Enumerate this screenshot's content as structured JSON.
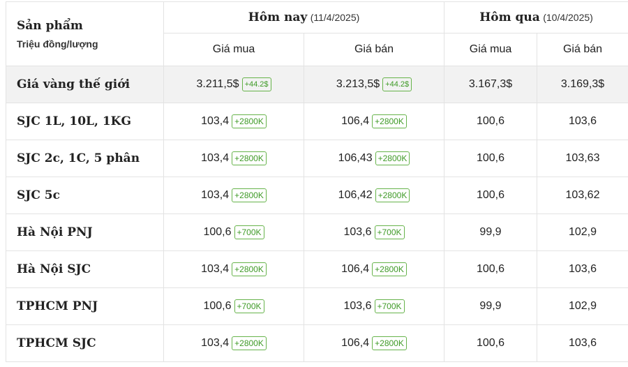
{
  "header": {
    "product_title": "Sản phẩm",
    "unit": "Triệu đồng/lượng",
    "today_title": "Hôm nay",
    "today_date": "(11/4/2025)",
    "yesterday_title": "Hôm qua",
    "yesterday_date": "(10/4/2025)",
    "buy_label": "Giá mua",
    "sell_label": "Giá bán"
  },
  "colors": {
    "badge_green": "#3f9a27",
    "world_row_bg": "#f2f2f2",
    "border": "#e3e3e3"
  },
  "rows": [
    {
      "name": "Giá vàng thế giới",
      "today_buy": "3.211,5$",
      "today_buy_change": "+44.2$",
      "today_sell": "3.213,5$",
      "today_sell_change": "+44.2$",
      "yesterday_buy": "3.167,3$",
      "yesterday_sell": "3.169,3$"
    },
    {
      "name": "SJC 1L, 10L, 1KG",
      "today_buy": "103,4",
      "today_buy_change": "+2800K",
      "today_sell": "106,4",
      "today_sell_change": "+2800K",
      "yesterday_buy": "100,6",
      "yesterday_sell": "103,6"
    },
    {
      "name": "SJC 2c, 1C, 5 phân",
      "today_buy": "103,4",
      "today_buy_change": "+2800K",
      "today_sell": "106,43",
      "today_sell_change": "+2800K",
      "yesterday_buy": "100,6",
      "yesterday_sell": "103,63"
    },
    {
      "name": "SJC 5c",
      "today_buy": "103,4",
      "today_buy_change": "+2800K",
      "today_sell": "106,42",
      "today_sell_change": "+2800K",
      "yesterday_buy": "100,6",
      "yesterday_sell": "103,62"
    },
    {
      "name": "Hà Nội PNJ",
      "today_buy": "100,6",
      "today_buy_change": "+700K",
      "today_sell": "103,6",
      "today_sell_change": "+700K",
      "yesterday_buy": "99,9",
      "yesterday_sell": "102,9"
    },
    {
      "name": "Hà Nội SJC",
      "today_buy": "103,4",
      "today_buy_change": "+2800K",
      "today_sell": "106,4",
      "today_sell_change": "+2800K",
      "yesterday_buy": "100,6",
      "yesterday_sell": "103,6"
    },
    {
      "name": "TPHCM PNJ",
      "today_buy": "100,6",
      "today_buy_change": "+700K",
      "today_sell": "103,6",
      "today_sell_change": "+700K",
      "yesterday_buy": "99,9",
      "yesterday_sell": "102,9"
    },
    {
      "name": "TPHCM SJC",
      "today_buy": "103,4",
      "today_buy_change": "+2800K",
      "today_sell": "106,4",
      "today_sell_change": "+2800K",
      "yesterday_buy": "100,6",
      "yesterday_sell": "103,6"
    }
  ]
}
